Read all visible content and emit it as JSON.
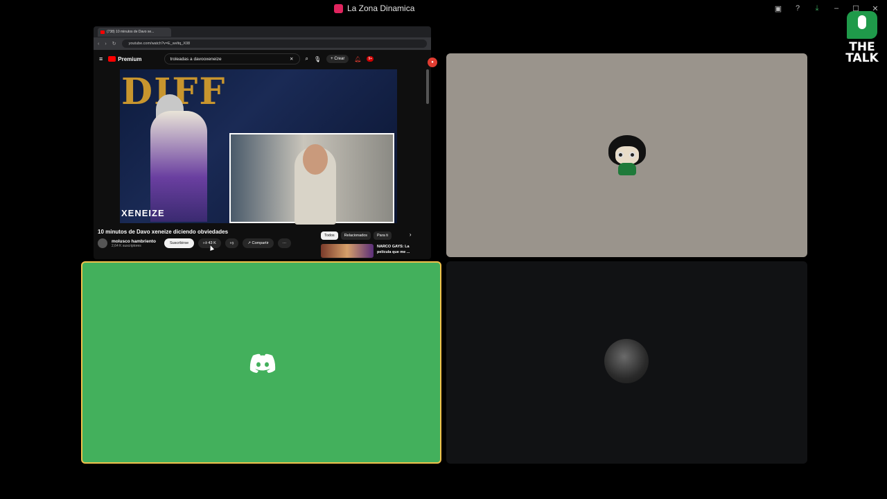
{
  "window": {
    "title": "La Zona Dinamica"
  },
  "overlay": {
    "brand_label": "THE TALK"
  },
  "browser": {
    "tab_title": "(738) 10 minutos de Davo xe...",
    "url": "youtube.com/watch?v=E_wvltq_X08",
    "youtube": {
      "logo_label": "Premium",
      "search_value": "troleadas a davooxeneize",
      "create_label": "Crear",
      "notification_count": "9+",
      "video": {
        "overlay_title": "DIFF",
        "overlay_caption": "XENEIZE",
        "title": "10 minutos de Davo xeneize diciendo obviedades",
        "channel_name": "molusco hambriento",
        "channel_subs": "2,64 K suscriptores",
        "subscribe_label": "Suscribirse",
        "likes": "43 K",
        "share_label": "Compartir"
      },
      "chips": [
        "Todos",
        "Relacionados",
        "Para ti"
      ],
      "recommendation": {
        "title": "NARCO GAYS: La película que me ..."
      }
    }
  },
  "tiles": {
    "active_speaker_color": "#43b05c",
    "highlight_color": "#f2c14b"
  }
}
